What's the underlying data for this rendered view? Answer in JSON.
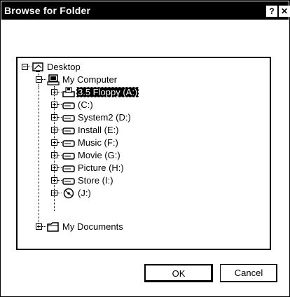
{
  "dialog": {
    "title": "Browse for Folder",
    "help_label": "?",
    "close_label": "✕"
  },
  "tree": {
    "desktop": "Desktop",
    "my_computer": "My Computer",
    "drives": [
      {
        "label": "3.5 Floppy (A:)",
        "icon": "floppy-drive-icon",
        "selected": true
      },
      {
        "label": "(C:)",
        "icon": "hard-drive-icon"
      },
      {
        "label": "System2 (D:)",
        "icon": "hard-drive-icon"
      },
      {
        "label": "Install (E:)",
        "icon": "hard-drive-icon"
      },
      {
        "label": "Music (F:)",
        "icon": "hard-drive-icon"
      },
      {
        "label": "Movie (G:)",
        "icon": "hard-drive-icon"
      },
      {
        "label": "Picture (H:)",
        "icon": "hard-drive-icon"
      },
      {
        "label": "Store (I:)",
        "icon": "hard-drive-icon"
      },
      {
        "label": "(J:)",
        "icon": "cd-drive-icon"
      }
    ],
    "my_documents": "My Documents"
  },
  "buttons": {
    "ok": "OK",
    "cancel": "Cancel"
  }
}
